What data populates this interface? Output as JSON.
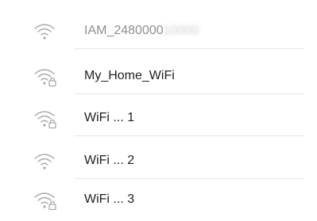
{
  "networks": [
    {
      "name": "IAM_2480000",
      "name_obscured": "10000",
      "secured": false,
      "connected": true
    },
    {
      "name": "My_Home_WiFi",
      "secured": true,
      "connected": false
    },
    {
      "name": "WiFi ... 1",
      "secured": true,
      "connected": false
    },
    {
      "name": "WiFi ... 2",
      "secured": false,
      "connected": false
    },
    {
      "name": "WiFi ... 3",
      "secured": true,
      "connected": false
    }
  ],
  "colors": {
    "icon": "#aaaaaa",
    "text": "#1f1f1f",
    "connected_text": "#8f8f8f",
    "divider": "#e6e6e6"
  },
  "icons": {
    "open": "wifi-icon",
    "secured": "wifi-lock-icon"
  }
}
